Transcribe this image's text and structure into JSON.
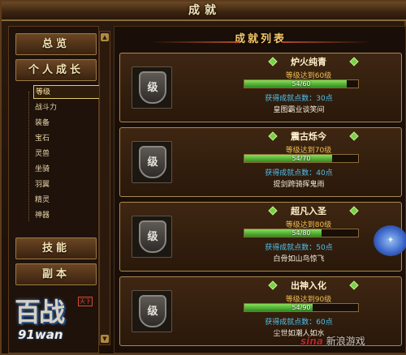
{
  "window": {
    "title": "成就"
  },
  "sidebar": {
    "categories": [
      {
        "label": "总览"
      },
      {
        "label": "个人成长"
      },
      {
        "label": "技能"
      },
      {
        "label": "副本"
      }
    ],
    "sub_items": [
      "等级",
      "战斗力",
      "装备",
      "宝石",
      "灵兽",
      "坐骑",
      "羽翼",
      "精灵",
      "神器"
    ],
    "active_sub": "等级"
  },
  "main": {
    "header": "成就列表",
    "icon_glyph": "级",
    "achievements": [
      {
        "name": "炉火纯青",
        "requirement": "等级达到60级",
        "progress": "54/60",
        "fraction": 0.9,
        "points": "获得成就点数：30点",
        "reward_title": "皇图霸业谈笑间"
      },
      {
        "name": "震古烁今",
        "requirement": "等级达到70级",
        "progress": "54/70",
        "fraction": 0.771,
        "points": "获得成就点数：40点",
        "reward_title": "提剑跨骑挥鬼雨"
      },
      {
        "name": "超凡入圣",
        "requirement": "等级达到80级",
        "progress": "54/80",
        "fraction": 0.675,
        "points": "获得成就点数：50点",
        "reward_title": "白骨如山鸟惊飞"
      },
      {
        "name": "出神入化",
        "requirement": "等级达到90级",
        "progress": "54/90",
        "fraction": 0.6,
        "points": "获得成就点数：60点",
        "reward_title": "尘世如潮人如水"
      }
    ]
  },
  "logo": {
    "text": "百战",
    "sub": "91wan",
    "mark": "天下"
  },
  "watermark": {
    "brand": "sina",
    "text": "新浪游戏"
  },
  "colors": {
    "accent": "#f6c86a",
    "progress": "#5ab83a",
    "points": "#4fc2f0"
  }
}
